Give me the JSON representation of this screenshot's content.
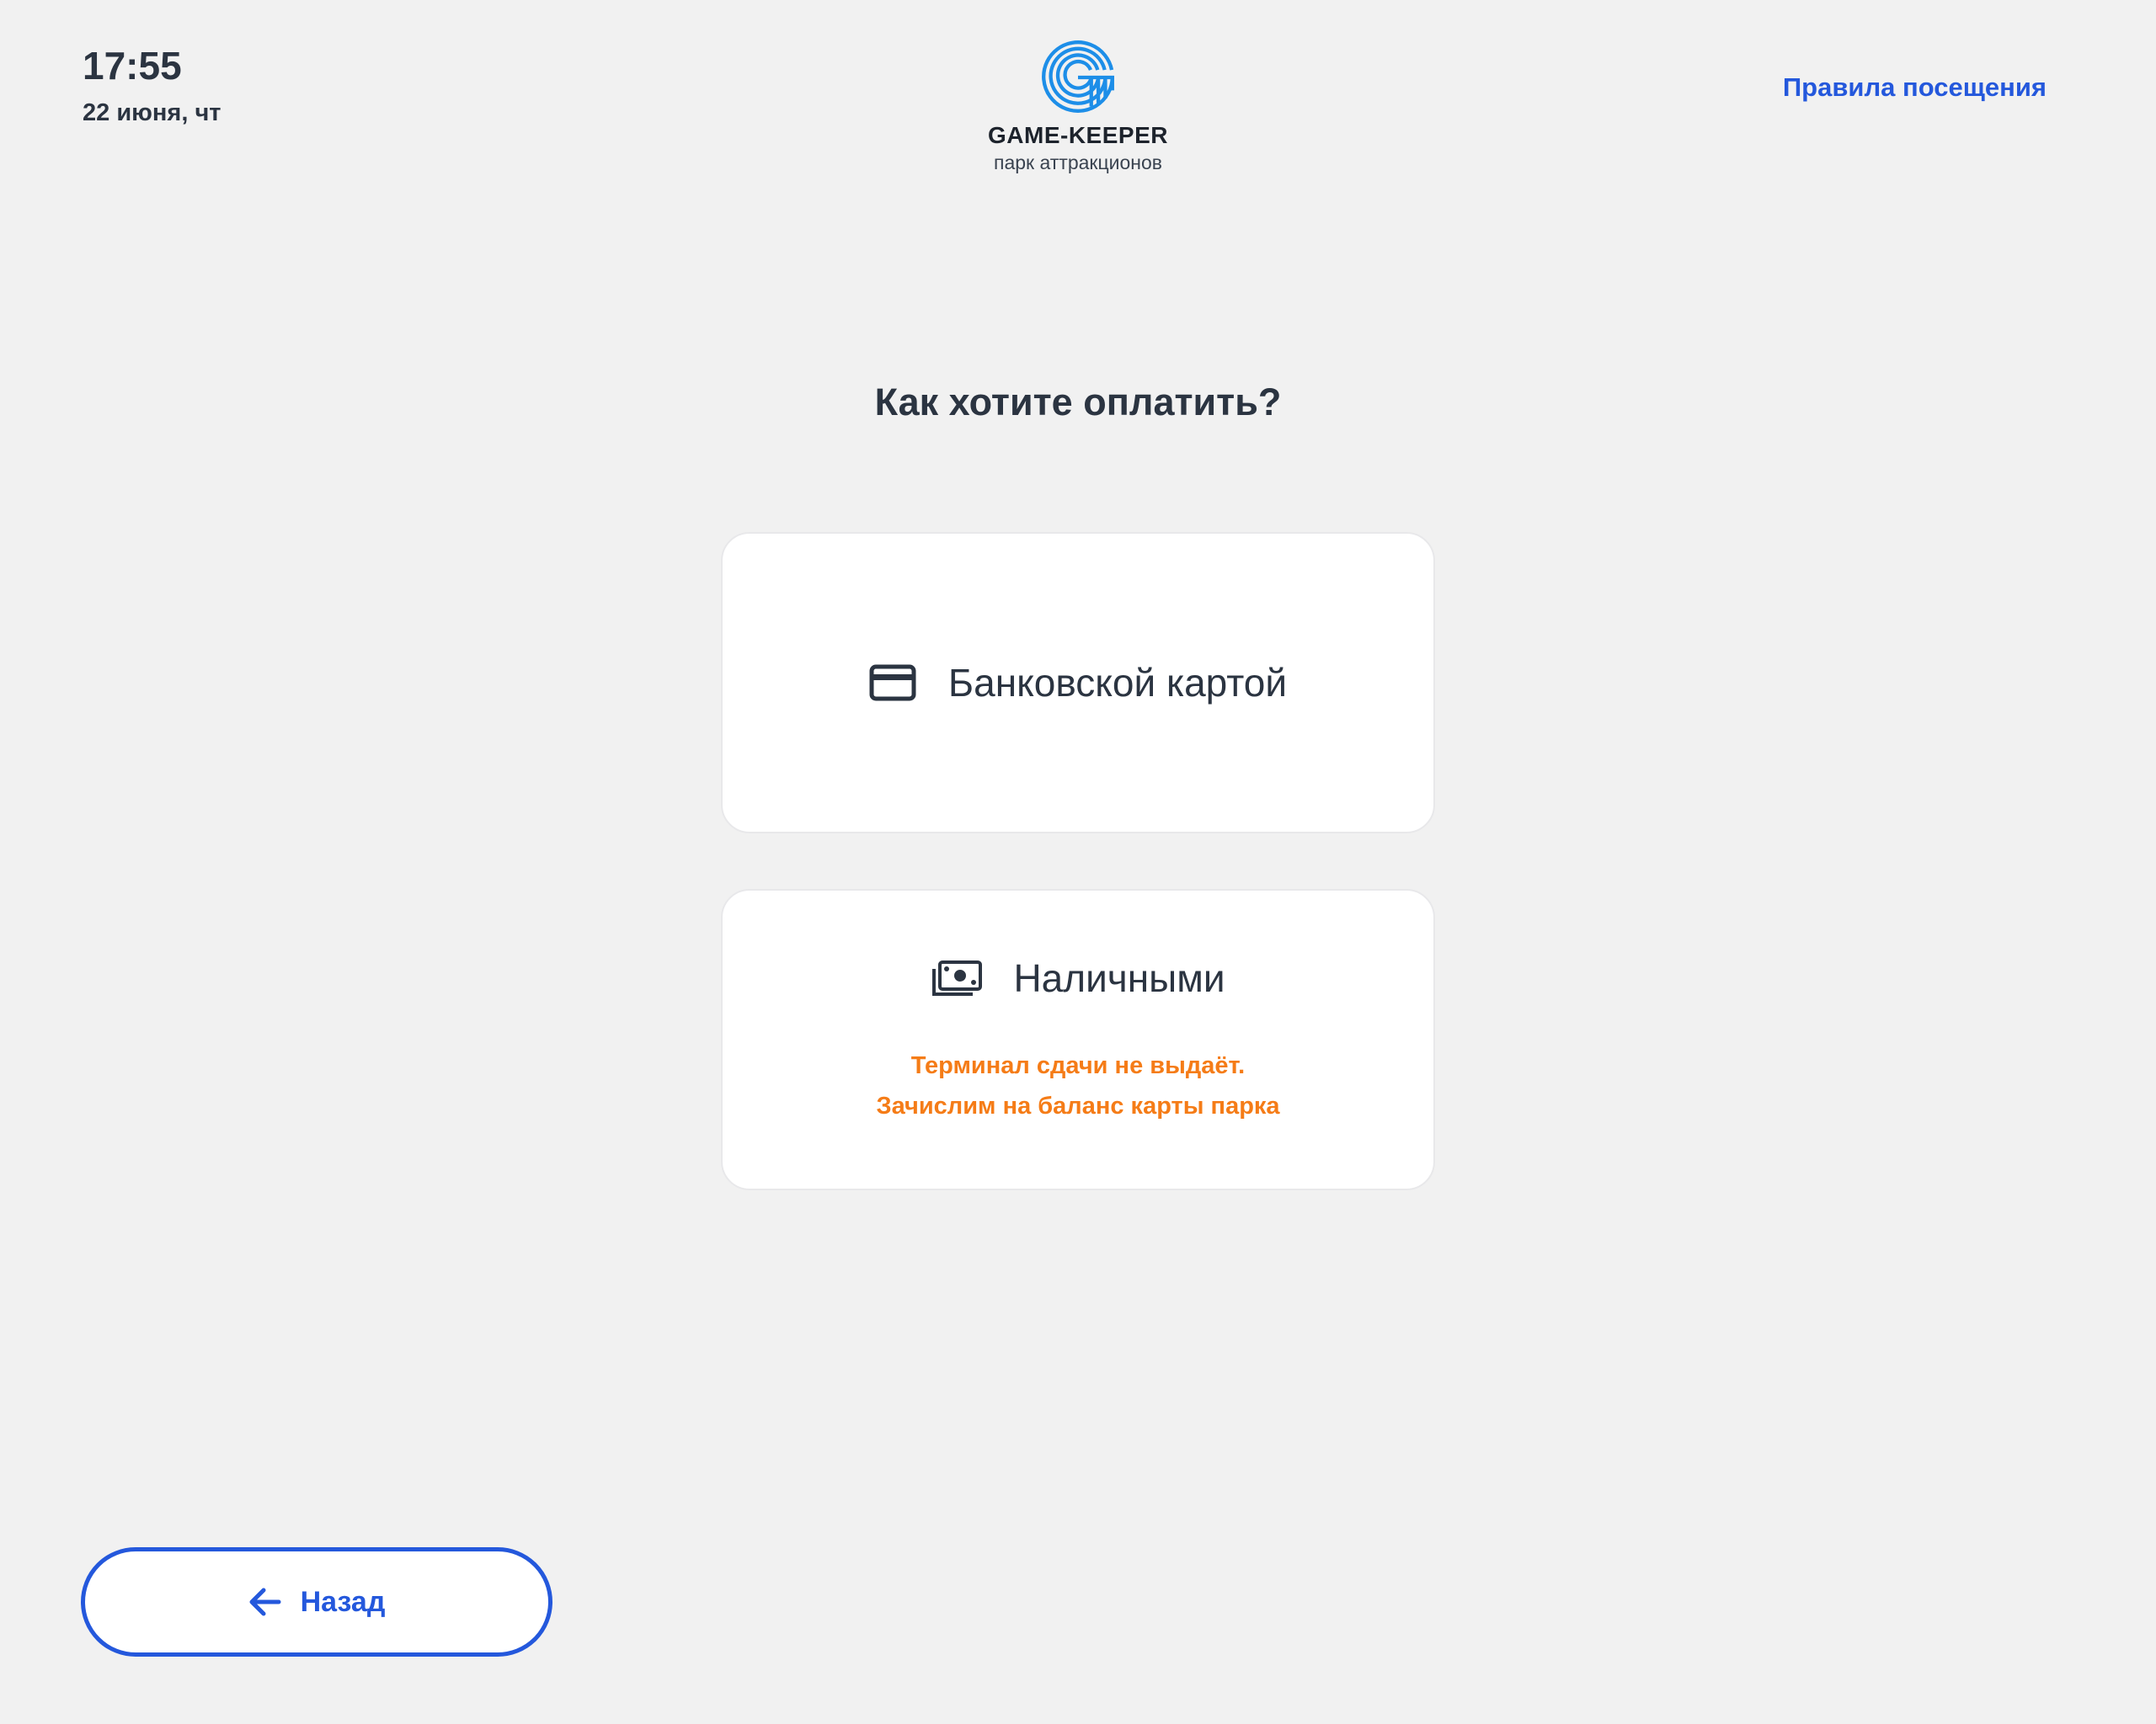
{
  "header": {
    "time": "17:55",
    "date": "22 июня, чт",
    "logo": {
      "icon": "game-keeper-logo-icon",
      "brand": "GAME-KEEPER",
      "tagline": "парк аттракционов"
    },
    "rules_link": "Правила посещения"
  },
  "main": {
    "title": "Как хотите оплатить?",
    "options": [
      {
        "id": "card",
        "icon": "credit-card-icon",
        "label": "Банковской картой"
      },
      {
        "id": "cash",
        "icon": "cash-icon",
        "label": "Наличными",
        "note_lines": [
          "Терминал сдачи не выдаёт.",
          "Зачислим на баланс карты парка"
        ]
      }
    ]
  },
  "footer": {
    "back_label": "Назад",
    "back_icon": "arrow-left-icon"
  },
  "colors": {
    "background": "#f1f1f1",
    "accent": "#2458dc",
    "logo": "#1d8ee8",
    "warning": "#f57c17",
    "text": "#2b3441"
  }
}
